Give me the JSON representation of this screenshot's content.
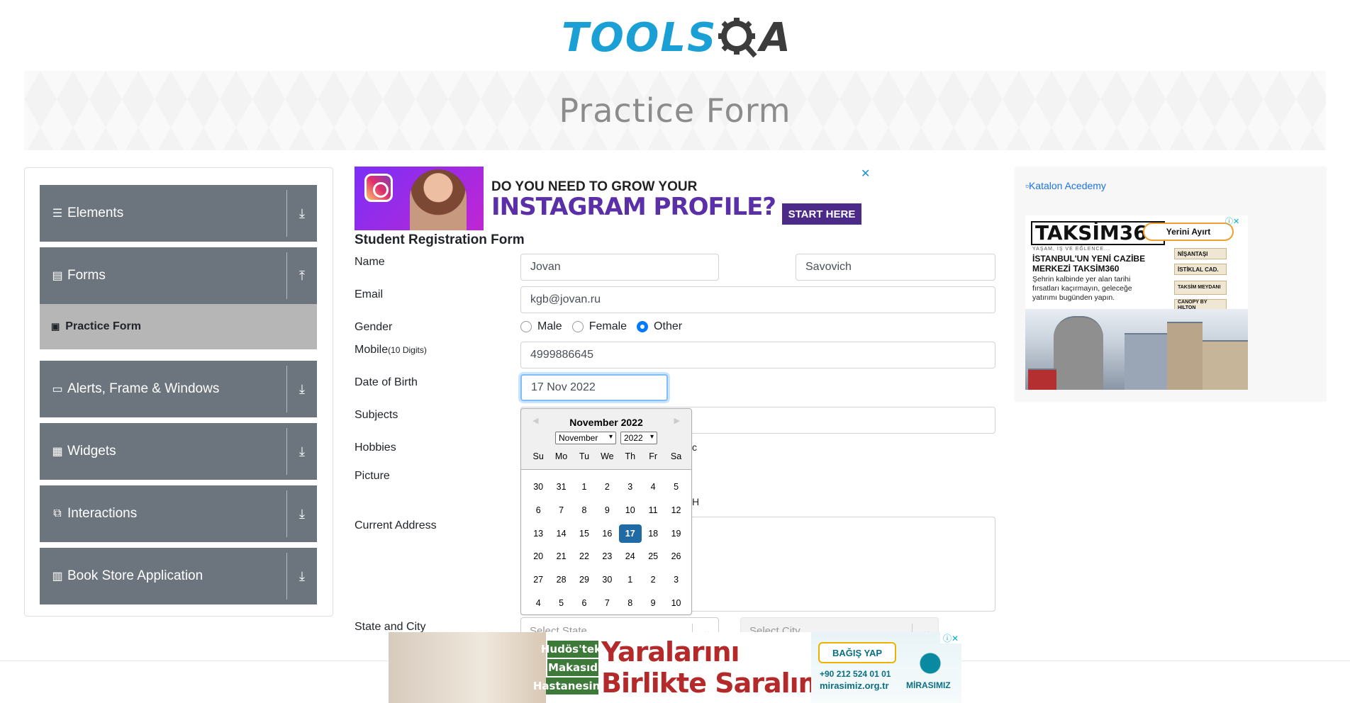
{
  "header": {
    "logo_tools": "TOOLS",
    "logo_qa": "A",
    "page_title": "Practice Form"
  },
  "sidebar": {
    "groups": [
      {
        "label": "Elements",
        "icon": "hamburger-icon",
        "arrow": "download-arrow-icon"
      },
      {
        "label": "Forms",
        "icon": "document-icon",
        "arrow": "upload-arrow-icon"
      },
      {
        "label": "Alerts, Frame & Windows",
        "icon": "window-icon",
        "arrow": "download-arrow-icon"
      },
      {
        "label": "Widgets",
        "icon": "grid-icon",
        "arrow": "download-arrow-icon"
      },
      {
        "label": "Interactions",
        "icon": "interaction-icon",
        "arrow": "download-arrow-icon"
      },
      {
        "label": "Book Store Application",
        "icon": "books-icon",
        "arrow": "download-arrow-icon"
      }
    ],
    "active_item": "Practice Form"
  },
  "ad_top": {
    "line1": "DO YOU NEED TO GROW YOUR",
    "line2": "INSTAGRAM PROFILE?",
    "cta": "START HERE",
    "close": "✕"
  },
  "form": {
    "title": "Student Registration Form",
    "name_label": "Name",
    "first_name": "Jovan",
    "last_name": "Savovich",
    "email_label": "Email",
    "email": "kgb@jovan.ru",
    "gender_label": "Gender",
    "gender_options": [
      "Male",
      "Female",
      "Other"
    ],
    "gender_selected": "Other",
    "mobile_label": "Mobile",
    "mobile_hint": "(10 Digits)",
    "mobile": "4999886645",
    "dob_label": "Date of Birth",
    "dob": "17 Nov 2022",
    "subjects_label": "Subjects",
    "hobbies_label": "Hobbies",
    "hobbies_partial": "c",
    "picture_label": "Picture",
    "picture_partial": "H",
    "address_label": "Current Address",
    "state_city_label": "State and City",
    "state_placeholder": "Select State",
    "city_placeholder": "Select City"
  },
  "calendar": {
    "month_title": "November 2022",
    "month_select": "November",
    "year_select": "2022",
    "weekdays": [
      "Su",
      "Mo",
      "Tu",
      "We",
      "Th",
      "Fr",
      "Sa"
    ],
    "weeks": [
      [
        "30",
        "31",
        "1",
        "2",
        "3",
        "4",
        "5"
      ],
      [
        "6",
        "7",
        "8",
        "9",
        "10",
        "11",
        "12"
      ],
      [
        "13",
        "14",
        "15",
        "16",
        "17",
        "18",
        "19"
      ],
      [
        "20",
        "21",
        "22",
        "23",
        "24",
        "25",
        "26"
      ],
      [
        "27",
        "28",
        "29",
        "30",
        "1",
        "2",
        "3"
      ],
      [
        "4",
        "5",
        "6",
        "7",
        "8",
        "9",
        "10"
      ]
    ],
    "selected_day": "17"
  },
  "right_ad": {
    "broken_image_alt": "Katalon Acedemy",
    "brand": "TAKSİM360",
    "tagline": "YAŞAM, İŞ VE EĞLENCE...",
    "heading": "İSTANBUL'UN YENİ CAZİBE MERKEZİ TAKSİM360",
    "body": "Şehrin kalbinde yer alan tarihi fırsatları kaçırmayın, geleceğe yatırımı bugünden yapın.",
    "button": "Yerini Ayırt",
    "signs": [
      "NİŞANTAŞI",
      "İSTİKLAL CAD.",
      "TAKSİM MEYDANI",
      "CANOPY BY HILTON"
    ]
  },
  "bottom_ad": {
    "badges": [
      "Hudös'teki",
      "Makasıd",
      "Hastanesinin"
    ],
    "headline1": "Yaralarını",
    "headline2": "Birlikte Saralım",
    "button": "BAĞIŞ YAP",
    "phone": "+90 212 524 01 01",
    "site": "mirasimiz.org.tr",
    "brand": "MİRASIMIZ"
  }
}
